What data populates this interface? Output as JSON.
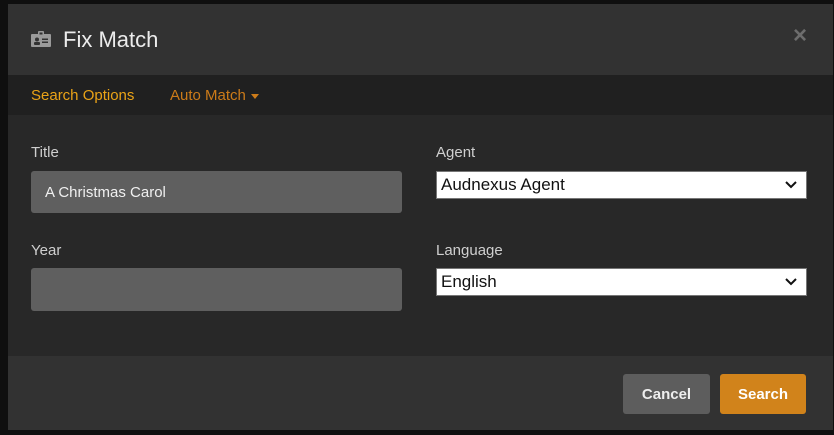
{
  "header": {
    "title": "Fix Match",
    "close_glyph": "×",
    "icon": "id-card-icon"
  },
  "tabs": {
    "search_options": "Search Options",
    "auto_match": "Auto Match"
  },
  "form": {
    "title_label": "Title",
    "title_value": "A Christmas Carol",
    "year_label": "Year",
    "year_value": "",
    "agent_label": "Agent",
    "agent_value": "Audnexus Agent",
    "language_label": "Language",
    "language_value": "English"
  },
  "buttons": {
    "cancel": "Cancel",
    "search": "Search"
  },
  "colors": {
    "accent": "#d1831b",
    "tab_active": "#eaa317",
    "background": "#282828"
  }
}
